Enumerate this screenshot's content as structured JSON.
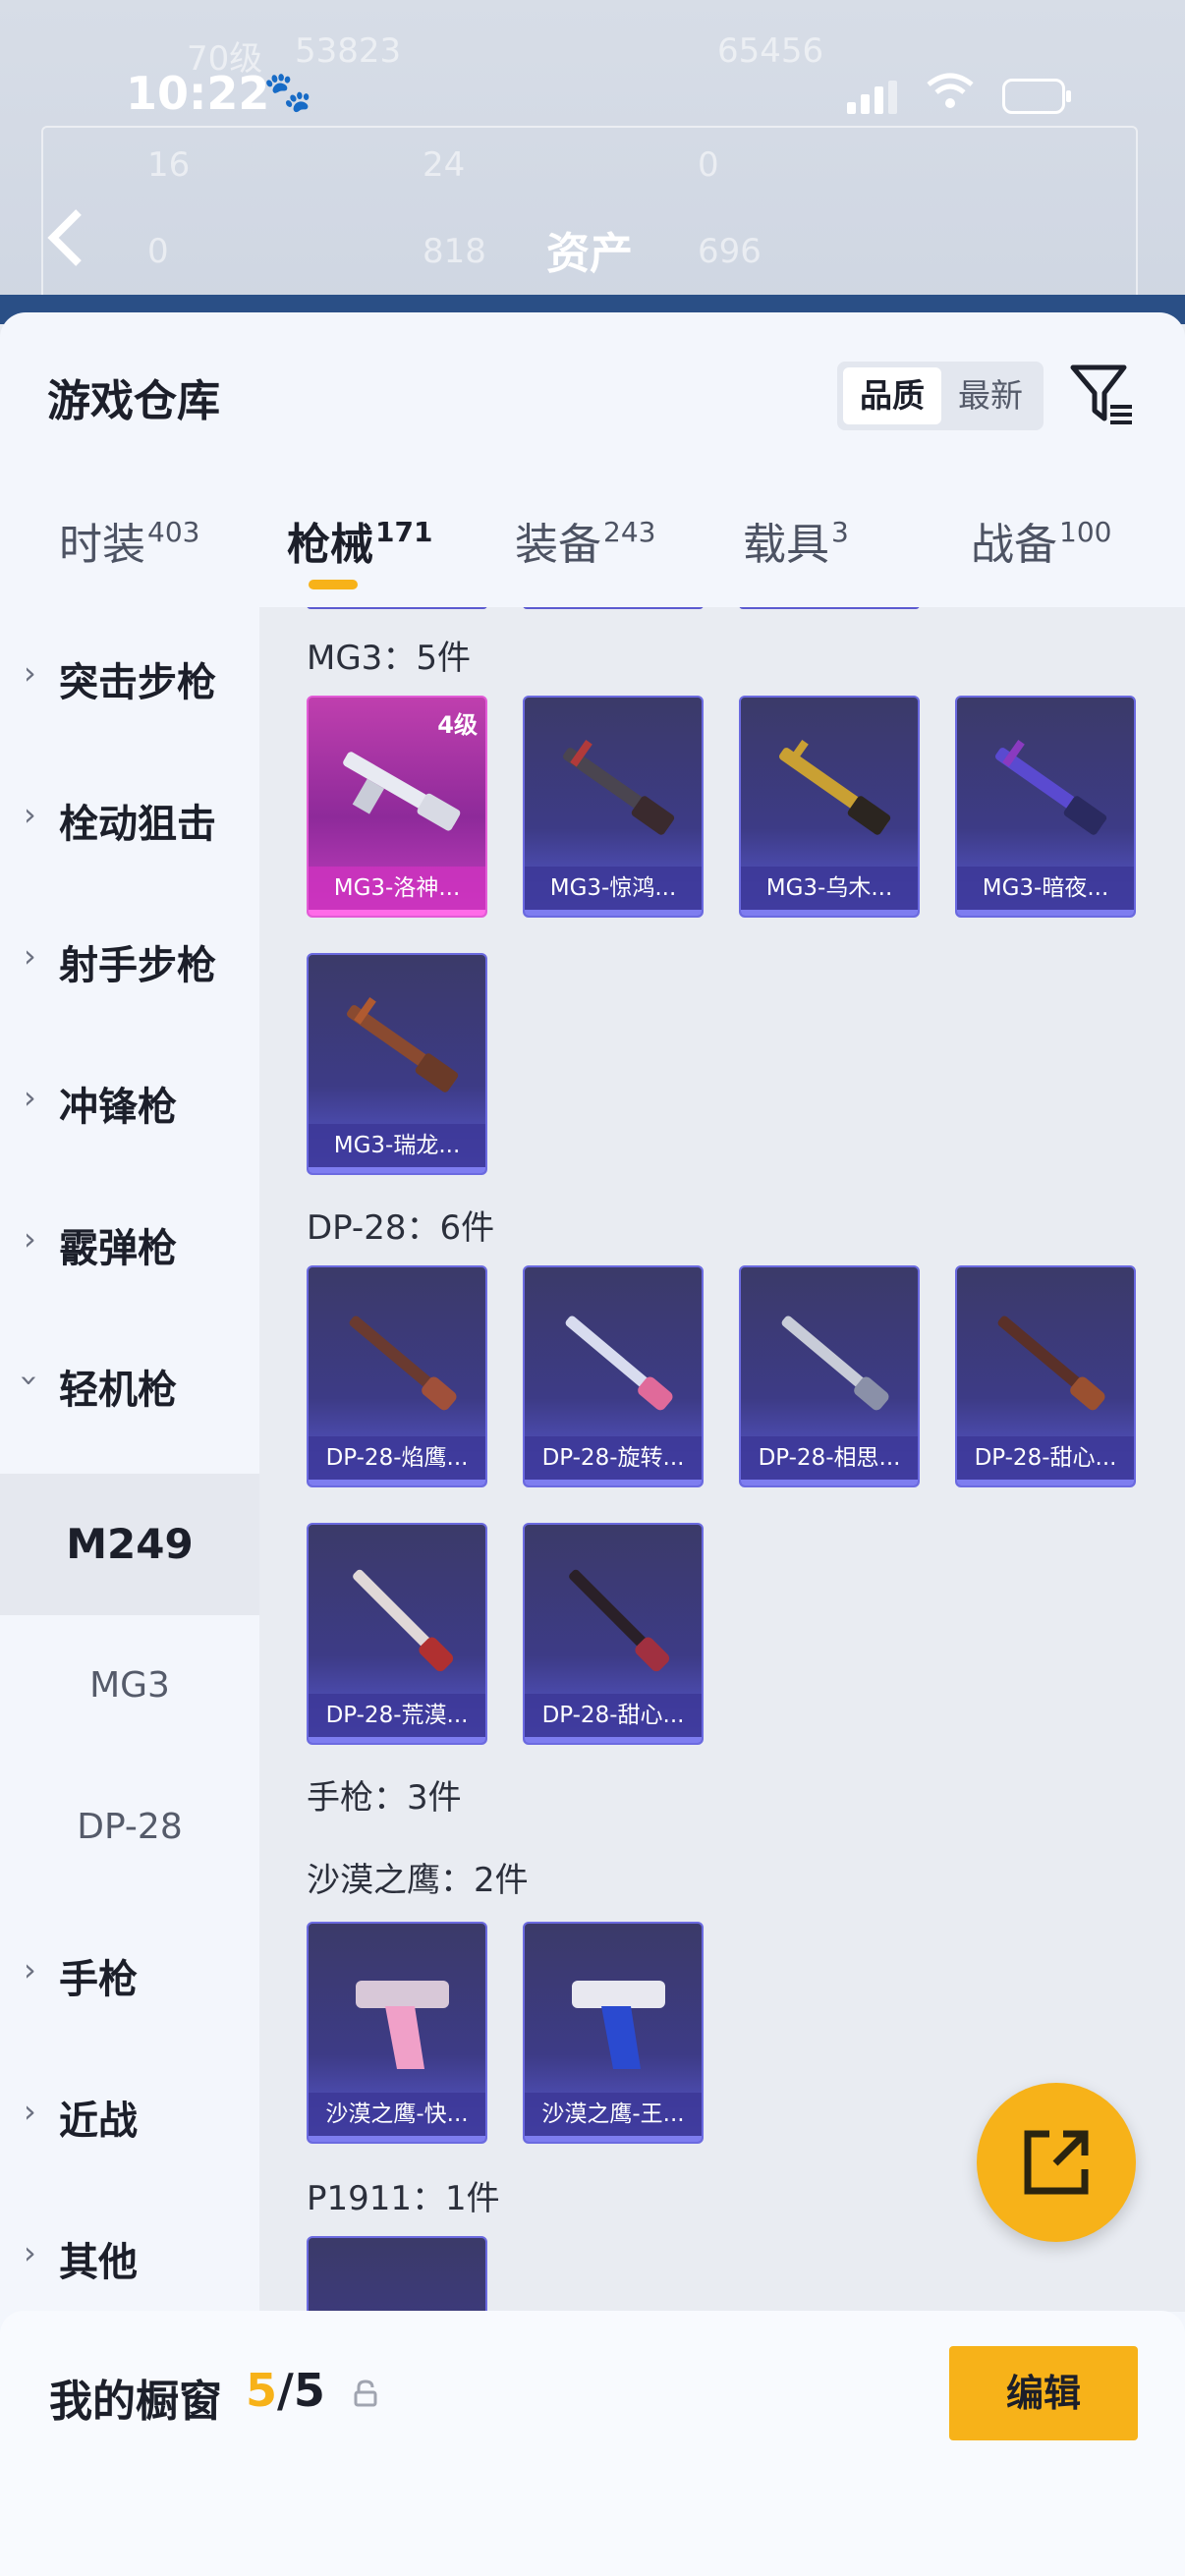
{
  "status_bar": {
    "time": "10:22"
  },
  "background": {
    "level": "70级",
    "popularity": "53823",
    "score": "65456",
    "stats": [
      "16",
      "24",
      "0",
      "0",
      "818",
      "696"
    ],
    "title": "资产"
  },
  "sheet": {
    "title": "游戏仓库",
    "sort": {
      "options": [
        "品质",
        "最新"
      ],
      "selected": "品质"
    }
  },
  "tabs": [
    {
      "label": "时装",
      "count": "403"
    },
    {
      "label": "枪械",
      "count": "171",
      "active": true
    },
    {
      "label": "装备",
      "count": "243"
    },
    {
      "label": "载具",
      "count": "3"
    },
    {
      "label": "战备",
      "count": "100"
    }
  ],
  "sidebar": {
    "categories": [
      {
        "label": "突击步枪",
        "chevron": "chevron-right"
      },
      {
        "label": "栓动狙击",
        "chevron": "chevron-right"
      },
      {
        "label": "射手步枪",
        "chevron": "chevron-right"
      },
      {
        "label": "冲锋枪",
        "chevron": "chevron-right"
      },
      {
        "label": "霰弹枪",
        "chevron": "chevron-right"
      },
      {
        "label": "轻机枪",
        "chevron": "chevron-down"
      }
    ],
    "subitems": [
      {
        "label": "M249",
        "active": true
      },
      {
        "label": "MG3"
      },
      {
        "label": "DP-28"
      }
    ],
    "more_categories": [
      {
        "label": "手枪"
      },
      {
        "label": "近战"
      },
      {
        "label": "其他"
      }
    ]
  },
  "content": {
    "groups": [
      {
        "title": "MG3：5件",
        "items": [
          {
            "name": "MG3-洛神...",
            "level": "4级",
            "rarity": "pink"
          },
          {
            "name": "MG3-惊鸿..."
          },
          {
            "name": "MG3-乌木..."
          },
          {
            "name": "MG3-暗夜..."
          },
          {
            "name": "MG3-瑞龙..."
          }
        ]
      },
      {
        "title": "DP-28：6件",
        "items": [
          {
            "name": "DP-28-焰鹰..."
          },
          {
            "name": "DP-28-旋转..."
          },
          {
            "name": "DP-28-相思..."
          },
          {
            "name": "DP-28-甜心..."
          },
          {
            "name": "DP-28-荒漠..."
          },
          {
            "name": "DP-28-甜心..."
          }
        ]
      },
      {
        "title": "手枪：3件",
        "items": []
      },
      {
        "title": "沙漠之鹰：2件",
        "items": [
          {
            "name": "沙漠之鹰-快..."
          },
          {
            "name": "沙漠之鹰-王..."
          }
        ]
      },
      {
        "title": "P1911：1件",
        "items": []
      }
    ]
  },
  "bottom_bar": {
    "label": "我的橱窗",
    "current": "5",
    "total": "/5",
    "edit_label": "编辑"
  },
  "colors": {
    "accent": "#f7b219",
    "card_purple": "#3d3b86",
    "card_pink": "#bf3fae"
  },
  "icons": [
    "back-icon",
    "filter-icon",
    "share-icon",
    "lock-icon",
    "chevron-right-icon",
    "chevron-down-icon"
  ]
}
